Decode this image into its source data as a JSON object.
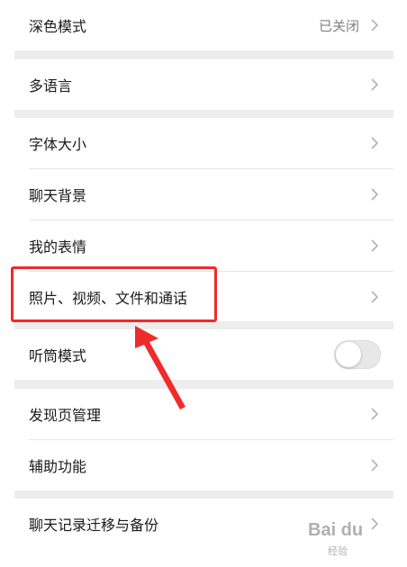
{
  "settings": {
    "dark_mode": {
      "label": "深色模式",
      "value": "已关闭"
    },
    "language": {
      "label": "多语言"
    },
    "font_size": {
      "label": "字体大小"
    },
    "chat_background": {
      "label": "聊天背景"
    },
    "my_stickers": {
      "label": "我的表情"
    },
    "media_files": {
      "label": "照片、视频、文件和通话"
    },
    "earpiece_mode": {
      "label": "听筒模式",
      "enabled": false
    },
    "discover_manage": {
      "label": "发现页管理"
    },
    "accessibility": {
      "label": "辅助功能"
    },
    "chat_history": {
      "label": "聊天记录迁移与备份"
    }
  },
  "colors": {
    "highlight": "#f02b2b",
    "page_background": "#ededed",
    "text": "#1a1a1a",
    "secondary_text": "#808080"
  },
  "watermark": {
    "text": "Bai du",
    "subtext": "经验"
  }
}
